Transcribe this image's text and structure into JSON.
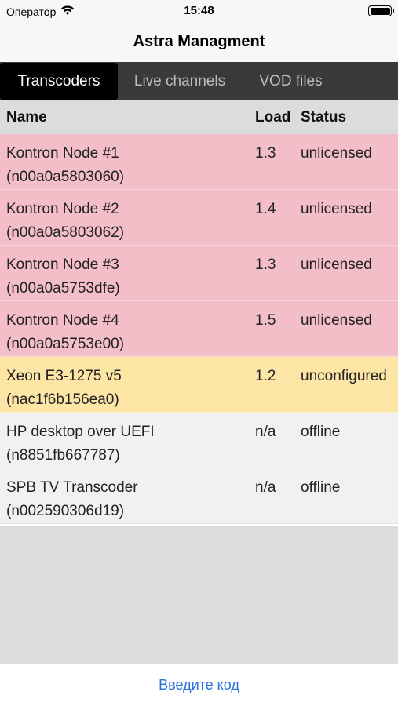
{
  "status_bar": {
    "carrier": "Оператор",
    "time": "15:48",
    "icons": [
      "wifi-icon",
      "battery-icon"
    ]
  },
  "nav": {
    "title": "Astra Managment"
  },
  "tabs": [
    {
      "label": "Transcoders",
      "active": true
    },
    {
      "label": "Live channels",
      "active": false
    },
    {
      "label": "VOD files",
      "active": false
    }
  ],
  "table": {
    "headers": {
      "name": "Name",
      "load": "Load",
      "status": "Status"
    },
    "rows": [
      {
        "name": "Kontron Node #1",
        "id": "(n00a0a5803060)",
        "load": "1.3",
        "status": "unlicensed"
      },
      {
        "name": "Kontron Node #2",
        "id": "(n00a0a5803062)",
        "load": "1.4",
        "status": "unlicensed"
      },
      {
        "name": "Kontron Node #3",
        "id": "(n00a0a5753dfe)",
        "load": "1.3",
        "status": "unlicensed"
      },
      {
        "name": "Kontron Node #4",
        "id": "(n00a0a5753e00)",
        "load": "1.5",
        "status": "unlicensed"
      },
      {
        "name": "Xeon E3-1275 v5",
        "id": "(nac1f6b156ea0)",
        "load": "1.2",
        "status": "unconfigured"
      },
      {
        "name": "HP desktop over UEFI",
        "id": "(n8851fb667787)",
        "load": "n/a",
        "status": "offline"
      },
      {
        "name": "SPB TV Transcoder",
        "id": "(n002590306d19)",
        "load": "n/a",
        "status": "offline"
      }
    ]
  },
  "footer": {
    "enter_code": "Введите код"
  },
  "colors": {
    "unlicensed": "#f3bec7",
    "unconfigured": "#fde5a6",
    "offline": "#f1f1f1",
    "link": "#2a73d9"
  }
}
